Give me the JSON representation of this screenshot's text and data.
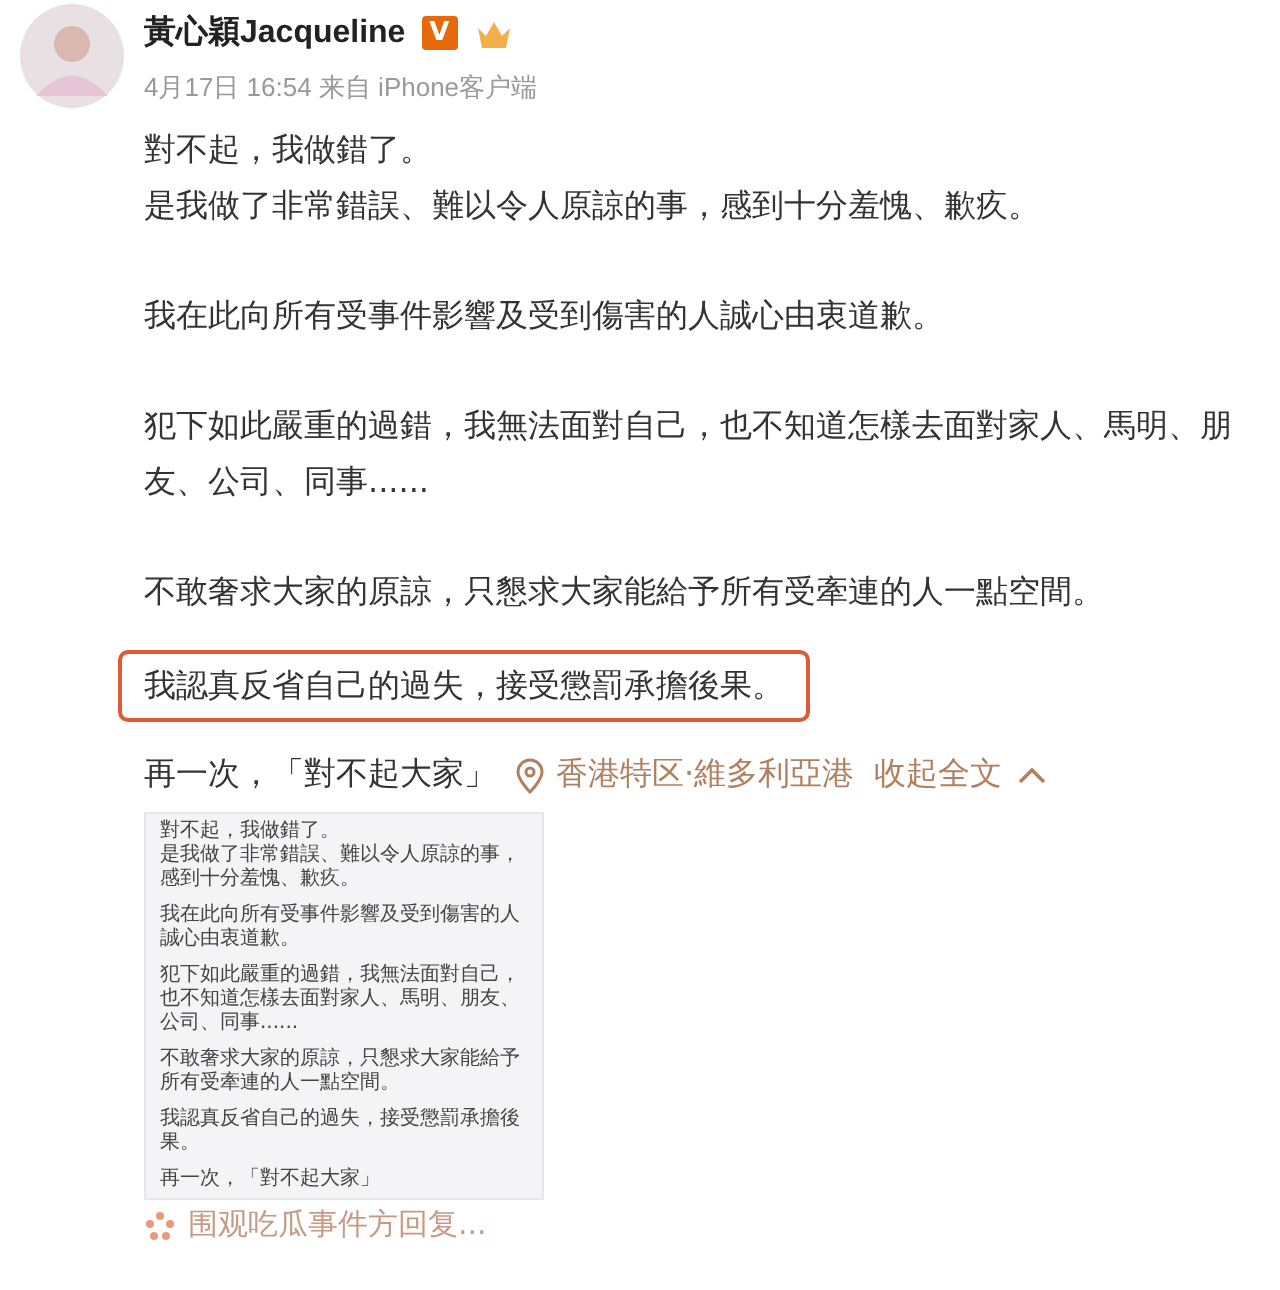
{
  "post": {
    "author": "黃心穎Jacqueline",
    "verified_badge": "V",
    "meta": "4月17日 16:54 来自 iPhone客户端",
    "paragraphs": [
      {
        "lines": [
          "對不起，我做錯了。",
          "是我做了非常錯誤、難以令人原諒的事，感到十分羞愧、歉疚。"
        ],
        "highlighted": false
      },
      {
        "lines": [
          "我在此向所有受事件影響及受到傷害的人誠心由衷道歉。"
        ],
        "highlighted": false
      },
      {
        "lines": [
          "犯下如此嚴重的過錯，我無法面對自己，也不知道怎樣去面對家人、馬明、朋友、公司、同事......"
        ],
        "highlighted": false
      },
      {
        "lines": [
          "不敢奢求大家的原諒，只懇求大家能給予所有受牽連的人一點空間。"
        ],
        "highlighted": false
      },
      {
        "lines": [
          "我認真反省自己的過失，接受懲罰承擔後果。"
        ],
        "highlighted": true
      }
    ],
    "last_line": "再一次，「對不起大家」",
    "location": "香港特区·維多利亞港",
    "collapse": "收起全文",
    "attachment": {
      "kind": "screenshot",
      "paragraphs": [
        [
          "對不起，我做錯了。",
          "是我做了非常錯誤、難以令人原諒的事，感到十分羞愧、歉疚。"
        ],
        [
          "我在此向所有受事件影響及受到傷害的人誠心由衷道歉。"
        ],
        [
          "犯下如此嚴重的過錯，我無法面對自己，也不知道怎樣去面對家人、馬明、朋友、公司、同事......"
        ],
        [
          "不敢奢求大家的原諒，只懇求大家能給予所有受牽連的人一點空間。"
        ],
        [
          "我認真反省自己的過失，接受懲罰承擔後果。"
        ],
        [
          "再一次，「對不起大家」"
        ]
      ]
    },
    "footer": "围观吃瓜事件方回复..."
  }
}
